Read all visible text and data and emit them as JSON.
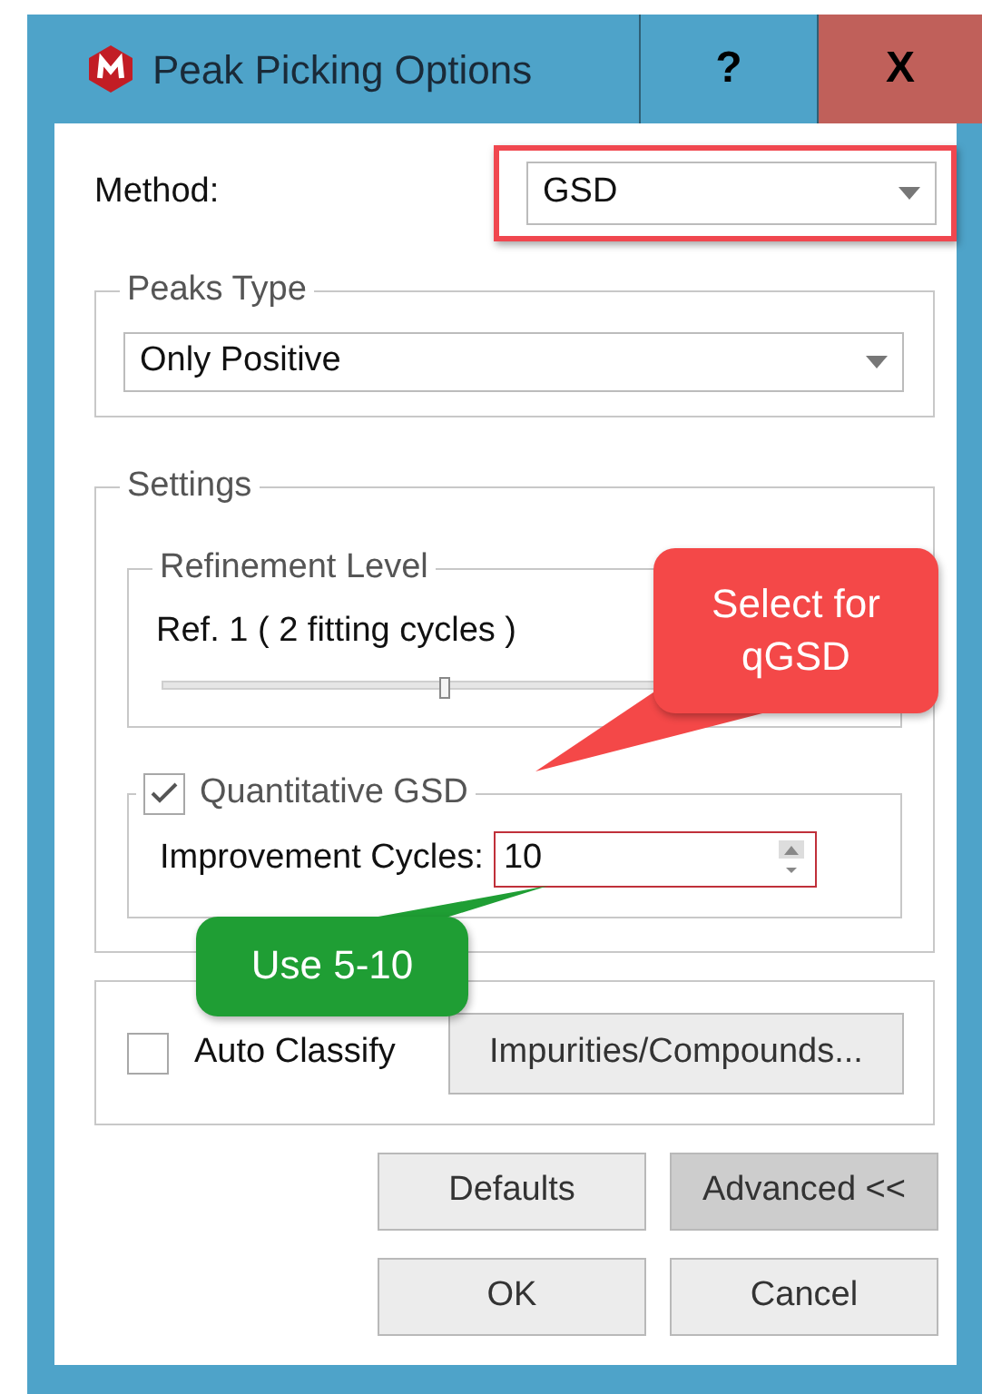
{
  "window": {
    "title": "Peak Picking Options",
    "help_button": "?",
    "close_button": "X"
  },
  "method": {
    "label": "Method:",
    "value": "GSD",
    "highlighted": true
  },
  "peaks_type": {
    "title": "Peaks Type",
    "value": "Only Positive"
  },
  "settings": {
    "title": "Settings",
    "refinement": {
      "title": "Refinement Level",
      "text": "Ref. 1 ( 2 fitting cycles )",
      "level": 0.4
    },
    "quantitative": {
      "label": "Quantitative GSD",
      "checked": true,
      "improvement_label": "Improvement Cycles:",
      "improvement_value": "10",
      "highlighted": true
    }
  },
  "auto_classify": {
    "label": "Auto Classify",
    "checked": false,
    "button": "Impurities/Compounds..."
  },
  "buttons": [
    {
      "label": "Defaults",
      "pressed": false
    },
    {
      "label": "Advanced <<",
      "pressed": true
    },
    {
      "label": "OK",
      "pressed": false
    },
    {
      "label": "Cancel",
      "pressed": false
    }
  ],
  "callouts": [
    {
      "text": "Select for qGSD",
      "color": "#f44848"
    },
    {
      "text": "Use 5-10",
      "color": "#1f9e34"
    }
  ]
}
